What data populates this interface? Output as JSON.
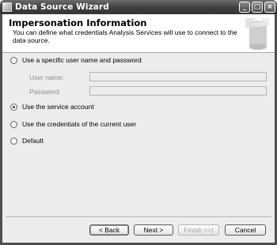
{
  "window": {
    "title": "Data Source Wizard",
    "controls": {
      "minimize": "_",
      "maximize": "□",
      "close": "×"
    }
  },
  "header": {
    "title": "Impersonation Information",
    "description": "You can define what credentials Analysis Services will use to connect to the data source."
  },
  "options": {
    "specific_user": {
      "label": "Use a specific user name and password",
      "checked": false
    },
    "service_account": {
      "label": "Use the service account",
      "checked": true
    },
    "current_user": {
      "label": "Use the credentials of the current user",
      "checked": false
    },
    "default": {
      "label": "Default",
      "checked": false
    }
  },
  "fields": {
    "username": {
      "label": "User name:",
      "value": ""
    },
    "password": {
      "label": "Password:",
      "value": ""
    }
  },
  "buttons": {
    "back": "< Back",
    "next": "Next >",
    "finish": "Finish >>|",
    "cancel": "Cancel"
  },
  "icons": {
    "window": "wizard-window-icon",
    "header_art": "database-cylinder-icon"
  },
  "colors": {
    "titlebar": "#3e3e3e",
    "client_bg": "#ececec",
    "header_bg": "#ffffff",
    "disabled_text": "#8f8f8f"
  }
}
